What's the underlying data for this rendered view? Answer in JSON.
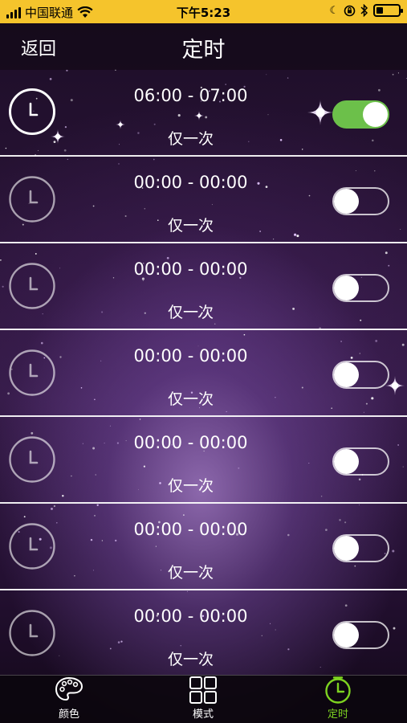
{
  "status_bar": {
    "carrier": "中国联通",
    "time": "下午5:23",
    "signal_bars": 4,
    "battery_level": 0.3
  },
  "nav": {
    "back_label": "返回",
    "title": "定时"
  },
  "timers": [
    {
      "time_range": "06:00 - 07:00",
      "repeat": "仅一次",
      "enabled": true,
      "active": true
    },
    {
      "time_range": "00:00 - 00:00",
      "repeat": "仅一次",
      "enabled": false,
      "active": false
    },
    {
      "time_range": "00:00 - 00:00",
      "repeat": "仅一次",
      "enabled": false,
      "active": false
    },
    {
      "time_range": "00:00 - 00:00",
      "repeat": "仅一次",
      "enabled": false,
      "active": false
    },
    {
      "time_range": "00:00 - 00:00",
      "repeat": "仅一次",
      "enabled": false,
      "active": false
    },
    {
      "time_range": "00:00 - 00:00",
      "repeat": "仅一次",
      "enabled": false,
      "active": false
    },
    {
      "time_range": "00:00 - 00:00",
      "repeat": "仅一次",
      "enabled": false,
      "active": false
    }
  ],
  "tabs": [
    {
      "label": "颜色",
      "icon": "palette-icon",
      "active": false
    },
    {
      "label": "模式",
      "icon": "grid-icon",
      "active": false
    },
    {
      "label": "定时",
      "icon": "timer-icon",
      "active": true
    }
  ],
  "colors": {
    "status_bar_bg": "#f5c42c",
    "toggle_on": "#6cc04a",
    "active_tab": "#7ed321"
  }
}
